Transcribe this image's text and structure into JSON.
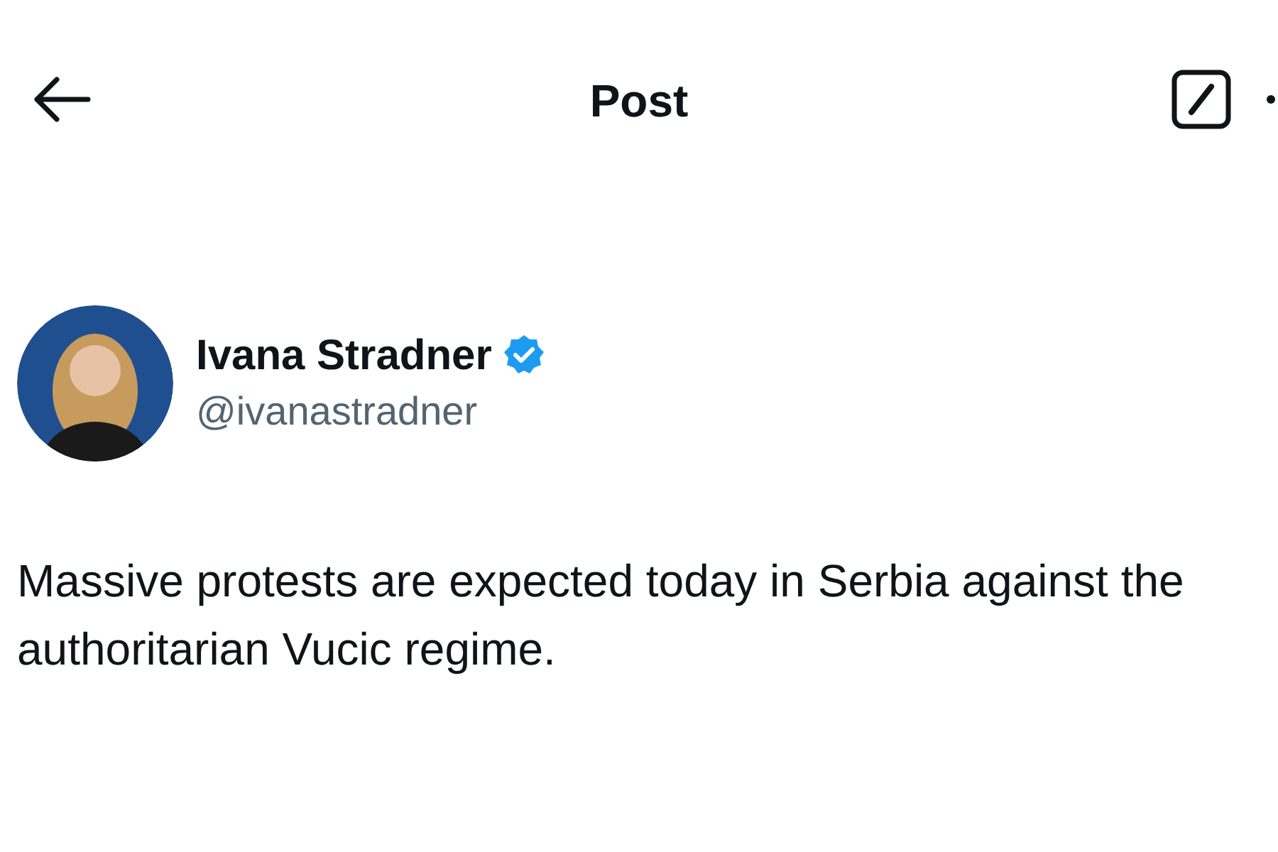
{
  "header": {
    "title": "Post"
  },
  "author": {
    "name": "Ivana Stradner",
    "verified": true,
    "handle": "@ivanastradner"
  },
  "post": {
    "text": "Massive protests are expected today in Serbia against the authoritarian Vucic regime."
  }
}
